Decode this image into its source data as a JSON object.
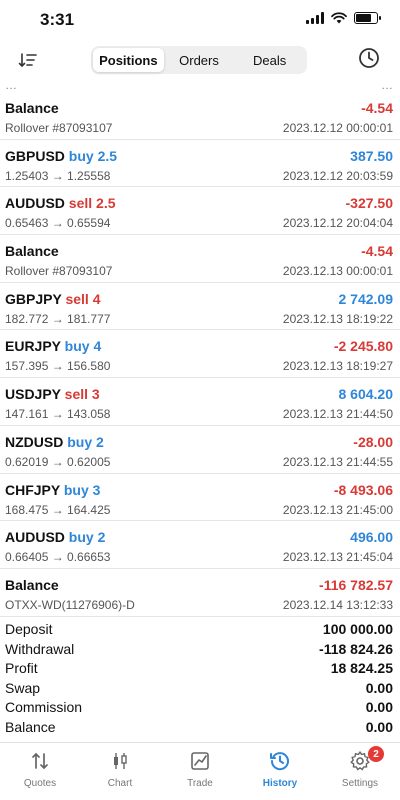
{
  "status_bar": {
    "time": "3:31"
  },
  "toolbar": {
    "tabs": [
      {
        "label": "Positions",
        "active": true
      },
      {
        "label": "Orders",
        "active": false
      },
      {
        "label": "Deals",
        "active": false
      }
    ]
  },
  "cut_row": {
    "left": "…",
    "right": "…"
  },
  "history": [
    {
      "symbol": "Balance",
      "direction": "",
      "volume": "",
      "sub": "Rollover #87093107",
      "value": "-4.54",
      "value_sign": "neg",
      "time": "2023.12.12 00:00:01"
    },
    {
      "symbol": "GBPUSD",
      "direction": "buy",
      "volume": "2.5",
      "sub": "1.25403 → 1.25558",
      "value": "387.50",
      "value_sign": "pos",
      "time": "2023.12.12 20:03:59"
    },
    {
      "symbol": "AUDUSD",
      "direction": "sell",
      "volume": "2.5",
      "sub": "0.65463 → 0.65594",
      "value": "-327.50",
      "value_sign": "neg",
      "time": "2023.12.12 20:04:04"
    },
    {
      "symbol": "Balance",
      "direction": "",
      "volume": "",
      "sub": "Rollover #87093107",
      "value": "-4.54",
      "value_sign": "neg",
      "time": "2023.12.13 00:00:01"
    },
    {
      "symbol": "GBPJPY",
      "direction": "sell",
      "volume": "4",
      "sub": "182.772 → 181.777",
      "value": "2 742.09",
      "value_sign": "pos",
      "time": "2023.12.13 18:19:22"
    },
    {
      "symbol": "EURJPY",
      "direction": "buy",
      "volume": "4",
      "sub": "157.395 → 156.580",
      "value": "-2 245.80",
      "value_sign": "neg",
      "time": "2023.12.13 18:19:27"
    },
    {
      "symbol": "USDJPY",
      "direction": "sell",
      "volume": "3",
      "sub": "147.161 → 143.058",
      "value": "8 604.20",
      "value_sign": "pos",
      "time": "2023.12.13 21:44:50"
    },
    {
      "symbol": "NZDUSD",
      "direction": "buy",
      "volume": "2",
      "sub": "0.62019 → 0.62005",
      "value": "-28.00",
      "value_sign": "neg",
      "time": "2023.12.13 21:44:55"
    },
    {
      "symbol": "CHFJPY",
      "direction": "buy",
      "volume": "3",
      "sub": "168.475 → 164.425",
      "value": "-8 493.06",
      "value_sign": "neg",
      "time": "2023.12.13 21:45:00"
    },
    {
      "symbol": "AUDUSD",
      "direction": "buy",
      "volume": "2",
      "sub": "0.66405 → 0.66653",
      "value": "496.00",
      "value_sign": "pos",
      "time": "2023.12.13 21:45:04"
    },
    {
      "symbol": "Balance",
      "direction": "",
      "volume": "",
      "sub": "OTXX-WD(11276906)-D",
      "value": "-116 782.57",
      "value_sign": "neg",
      "time": "2023.12.14 13:12:33"
    }
  ],
  "summary": [
    {
      "label": "Deposit",
      "value": "100 000.00"
    },
    {
      "label": "Withdrawal",
      "value": "-118 824.26"
    },
    {
      "label": "Profit",
      "value": "18 824.25"
    },
    {
      "label": "Swap",
      "value": "0.00"
    },
    {
      "label": "Commission",
      "value": "0.00"
    },
    {
      "label": "Balance",
      "value": "0.00"
    }
  ],
  "tabbar": {
    "items": [
      {
        "label": "Quotes",
        "icon": "quotes-icon",
        "active": false
      },
      {
        "label": "Chart",
        "icon": "chart-icon",
        "active": false
      },
      {
        "label": "Trade",
        "icon": "trade-icon",
        "active": false
      },
      {
        "label": "History",
        "icon": "history-icon",
        "active": true
      },
      {
        "label": "Settings",
        "icon": "settings-icon",
        "active": false,
        "badge": "2"
      }
    ]
  },
  "colors": {
    "buy": "#2f86d9",
    "sell": "#d83a35",
    "active_tab": "#2f86d9",
    "badge": "#e53935"
  }
}
